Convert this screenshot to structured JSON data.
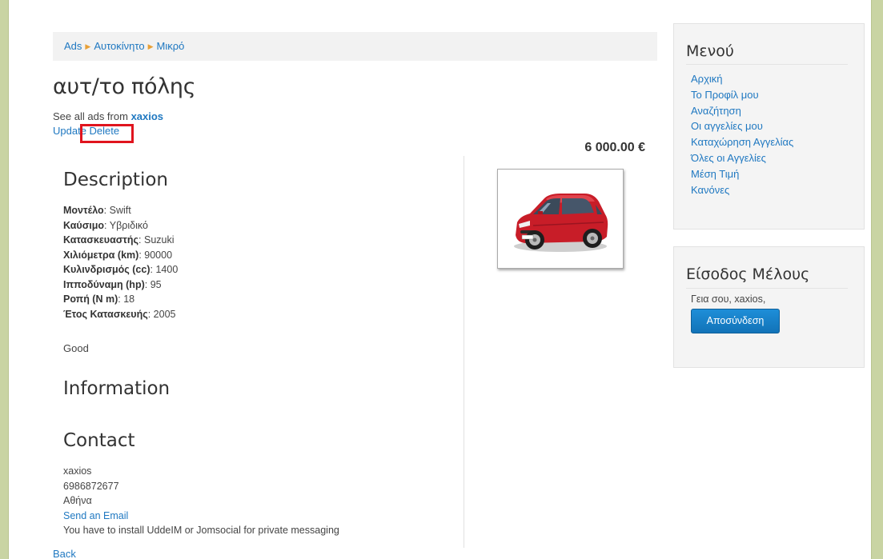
{
  "breadcrumb": {
    "items": [
      "Ads",
      "Αυτοκίνητο",
      "Μικρό"
    ]
  },
  "ad": {
    "title": "αυτ/το πόλης",
    "see_all_prefix": "See all ads from",
    "owner": "xaxios",
    "update_label": "Update",
    "delete_label": "Delete",
    "price": "6 000.00 €",
    "image_icon": "red-hatchback-car-image"
  },
  "description": {
    "heading": "Description",
    "fields": [
      {
        "label": "Μοντέλο",
        "value": "Swift"
      },
      {
        "label": "Καύσιμο",
        "value": "Υβριδικό"
      },
      {
        "label": "Κατασκευαστής",
        "value": "Suzuki"
      },
      {
        "label": "Χιλιόμετρα (km)",
        "value": "90000"
      },
      {
        "label": "Κυλινδρισμός (cc)",
        "value": "1400"
      },
      {
        "label": "Ιπποδύναμη (hp)",
        "value": "95"
      },
      {
        "label": "Ροπή (N m)",
        "value": "18"
      },
      {
        "label": "Έτος Κατασκευής",
        "value": "2005"
      }
    ],
    "note": "Good"
  },
  "information": {
    "heading": "Information"
  },
  "contact": {
    "heading": "Contact",
    "name": "xaxios",
    "phone": "6986872677",
    "city": "Αθήνα",
    "email_link": "Send an Email",
    "messaging_note": "You have to install UddeIM or Jomsocial for private messaging"
  },
  "back_label": "Back",
  "menu_module": {
    "title": "Μενού",
    "items": [
      "Αρχική",
      "Το Προφίλ μου",
      "Αναζήτηση",
      "Οι αγγελίες μου",
      "Καταχώρηση Αγγελίας",
      "Όλες οι Αγγελίες",
      "Μέση Τιμή",
      "Κανόνες"
    ]
  },
  "login_module": {
    "title": "Είσοδος Μέλους",
    "greeting": "Γεια σου, xaxios,",
    "logout_label": "Αποσύνδεση"
  },
  "colors": {
    "link": "#1f78c1",
    "highlight_box": "#e0141e",
    "breadcrumb_arrow": "#e8a036",
    "button": "#1273b8",
    "page_frame": "#c9d4a3"
  }
}
